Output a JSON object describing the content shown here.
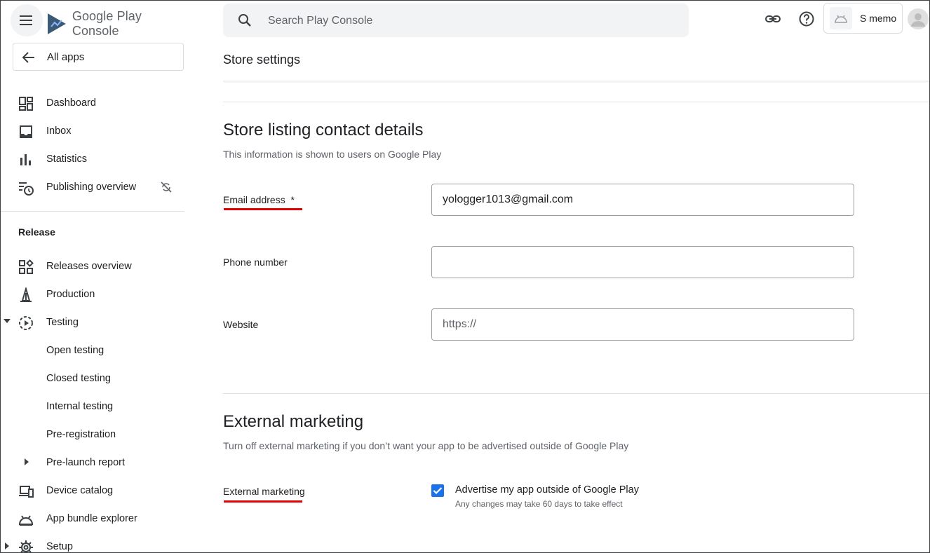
{
  "app": {
    "brand_google": "Google Play",
    "brand_console": "Console",
    "account_name": "S memo"
  },
  "search": {
    "placeholder": "Search Play Console"
  },
  "sidebar": {
    "all_apps": "All apps",
    "items": [
      {
        "label": "Dashboard",
        "icon": "dashboard-icon"
      },
      {
        "label": "Inbox",
        "icon": "inbox-icon"
      },
      {
        "label": "Statistics",
        "icon": "statistics-icon"
      },
      {
        "label": "Publishing overview",
        "icon": "publishing-overview-icon"
      }
    ],
    "release_section": "Release",
    "release_items": [
      {
        "label": "Releases overview",
        "icon": "releases-overview-icon"
      },
      {
        "label": "Production",
        "icon": "production-icon"
      },
      {
        "label": "Testing",
        "icon": "testing-icon"
      },
      {
        "label": "Open testing"
      },
      {
        "label": "Closed testing"
      },
      {
        "label": "Internal testing"
      },
      {
        "label": "Pre-registration"
      },
      {
        "label": "Pre-launch report"
      },
      {
        "label": "Device catalog",
        "icon": "device-catalog-icon"
      },
      {
        "label": "App bundle explorer",
        "icon": "app-bundle-explorer-icon"
      },
      {
        "label": "Setup",
        "icon": "gear-icon"
      }
    ]
  },
  "page": {
    "title": "Store settings",
    "contact": {
      "heading": "Store listing contact details",
      "subtitle": "This information is shown to users on Google Play",
      "email_label": "Email address",
      "email_required": "*",
      "email_value": "yologger1013@gmail.com",
      "phone_label": "Phone number",
      "phone_value": "",
      "website_label": "Website",
      "website_placeholder": "https://"
    },
    "marketing": {
      "heading": "External marketing",
      "subtitle": "Turn off external marketing if you don’t want your app to be advertised outside of Google Play",
      "label": "External marketing",
      "checkbox_label": "Advertise my app outside of Google Play",
      "checkbox_help": "Any changes may take 60 days to take effect",
      "checked": true
    }
  },
  "colors": {
    "accent": "#1a73e8",
    "annotation_red": "#e20000"
  }
}
